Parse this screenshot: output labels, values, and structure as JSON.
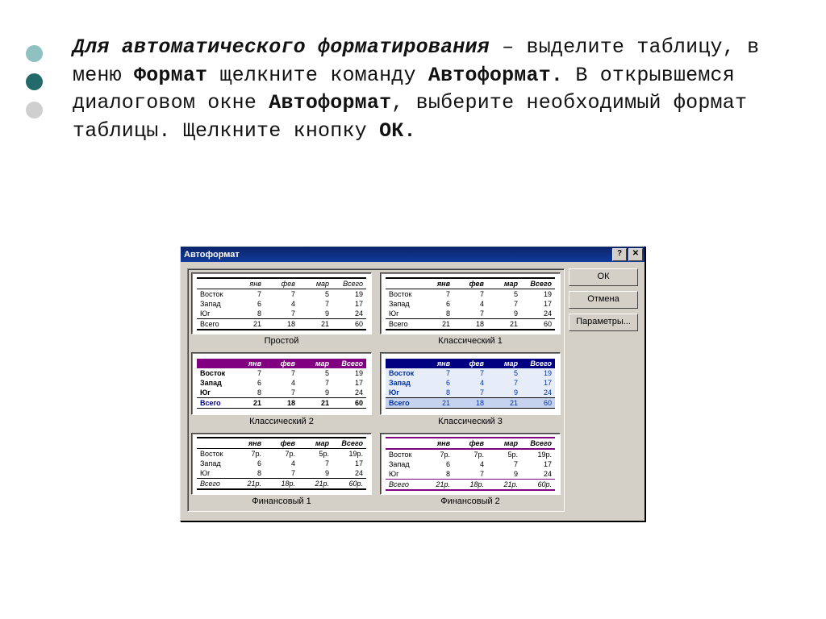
{
  "bullets": {
    "style": "three-dots"
  },
  "para": {
    "run1_bi": "Для автоматического форматирования",
    "run2": " – выделите таблицу, в меню ",
    "run3_b": "Формат",
    "run4": " щелкните команду ",
    "run5_b": "Автоформат.",
    "run6": " В открывшемся диалоговом окне ",
    "run7_b": "Автоформат",
    "run8": ", выберите необходимый формат таблицы. Щелкните кнопку ",
    "run9_b": "ОК."
  },
  "dialog": {
    "title": "Автоформат",
    "help_btn": "?",
    "close_btn": "✕",
    "buttons": {
      "ok": "ОК",
      "cancel": "Отмена",
      "params": "Параметры..."
    },
    "sample_headers": {
      "corner": "",
      "c1": "янв",
      "c2": "фев",
      "c3": "мар",
      "c4": "Всего"
    },
    "sample_rows": [
      {
        "label": "Восток",
        "v": [
          "7",
          "7",
          "5",
          "19"
        ]
      },
      {
        "label": "Запад",
        "v": [
          "6",
          "4",
          "7",
          "17"
        ]
      },
      {
        "label": "Юг",
        "v": [
          "8",
          "7",
          "9",
          "24"
        ]
      },
      {
        "label": "Всего",
        "v": [
          "21",
          "18",
          "21",
          "60"
        ],
        "total": true
      }
    ],
    "sample_rows_ruble": [
      {
        "label": "Восток",
        "v": [
          "7р.",
          "7р.",
          "5р.",
          "19р."
        ]
      },
      {
        "label": "Запад",
        "v": [
          "6",
          "4",
          "7",
          "17"
        ]
      },
      {
        "label": "Юг",
        "v": [
          "8",
          "7",
          "9",
          "24"
        ]
      },
      {
        "label": "Всего",
        "v": [
          "21р.",
          "18р.",
          "21р.",
          "60р."
        ],
        "total": true
      }
    ],
    "previews": [
      {
        "caption": "Простой",
        "style": "style1",
        "ruble": false
      },
      {
        "caption": "Классический 1",
        "style": "style2",
        "ruble": false
      },
      {
        "caption": "Классический 2",
        "style": "style3",
        "ruble": false
      },
      {
        "caption": "Классический 3",
        "style": "style4",
        "ruble": false
      },
      {
        "caption": "Финансовый 1",
        "style": "style5",
        "ruble": true
      },
      {
        "caption": "Финансовый 2",
        "style": "style6",
        "ruble": true
      }
    ]
  }
}
